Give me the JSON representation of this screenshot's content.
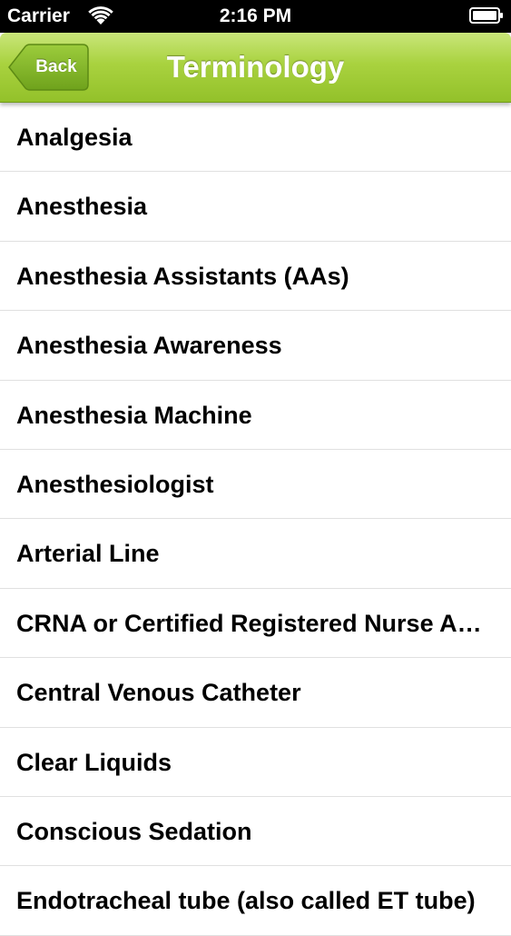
{
  "status_bar": {
    "carrier": "Carrier",
    "time": "2:16 PM",
    "wifi_icon": "wifi-icon",
    "battery_icon": "battery-icon"
  },
  "nav": {
    "back_label": "Back",
    "title": "Terminology",
    "accent_color": "#a9d23f"
  },
  "terms": [
    {
      "label": "Analgesia"
    },
    {
      "label": "Anesthesia"
    },
    {
      "label": "Anesthesia Assistants (AAs)"
    },
    {
      "label": "Anesthesia Awareness"
    },
    {
      "label": "Anesthesia Machine"
    },
    {
      "label": "Anesthesiologist"
    },
    {
      "label": "Arterial Line"
    },
    {
      "label": "CRNA or Certified Registered Nurse Anesthetist"
    },
    {
      "label": "Central Venous Catheter"
    },
    {
      "label": "Clear Liquids"
    },
    {
      "label": "Conscious Sedation"
    },
    {
      "label": "Endotracheal tube (also called ET tube)"
    }
  ]
}
